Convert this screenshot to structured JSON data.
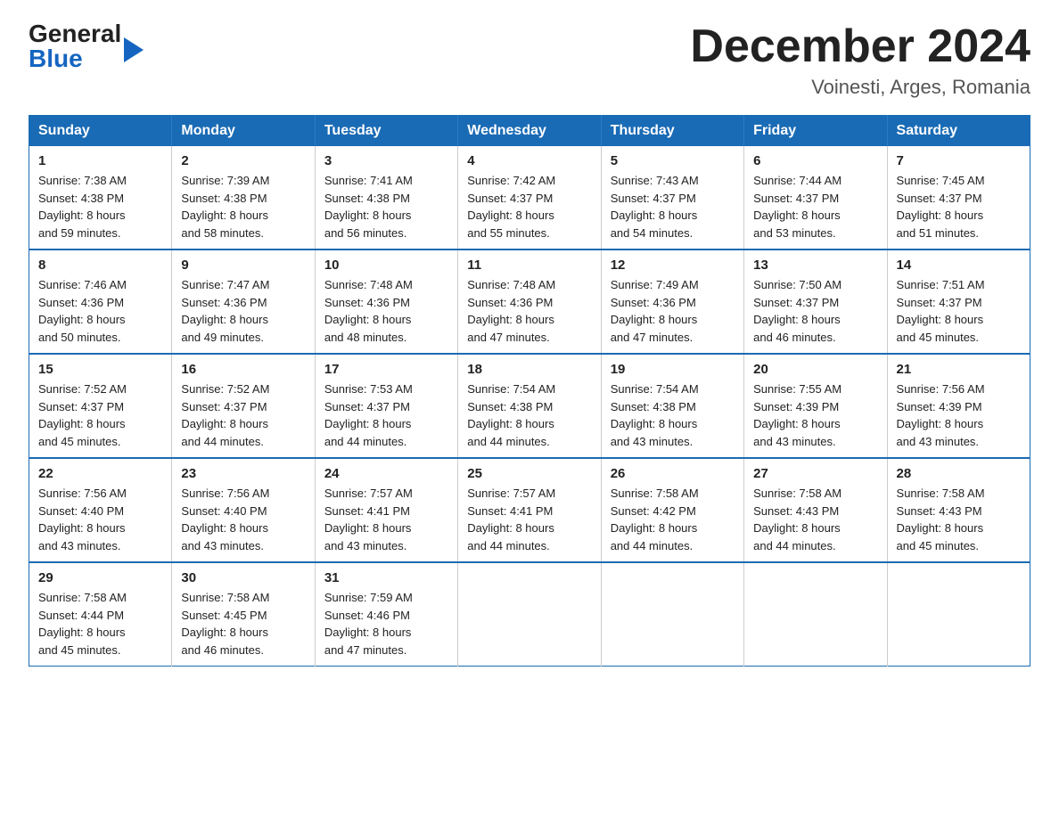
{
  "header": {
    "logo": {
      "line1": "General",
      "line2": "Blue"
    },
    "title": "December 2024",
    "location": "Voinesti, Arges, Romania"
  },
  "columns": [
    "Sunday",
    "Monday",
    "Tuesday",
    "Wednesday",
    "Thursday",
    "Friday",
    "Saturday"
  ],
  "weeks": [
    [
      {
        "day": "1",
        "sunrise": "7:38 AM",
        "sunset": "4:38 PM",
        "daylight": "8 hours and 59 minutes."
      },
      {
        "day": "2",
        "sunrise": "7:39 AM",
        "sunset": "4:38 PM",
        "daylight": "8 hours and 58 minutes."
      },
      {
        "day": "3",
        "sunrise": "7:41 AM",
        "sunset": "4:38 PM",
        "daylight": "8 hours and 56 minutes."
      },
      {
        "day": "4",
        "sunrise": "7:42 AM",
        "sunset": "4:37 PM",
        "daylight": "8 hours and 55 minutes."
      },
      {
        "day": "5",
        "sunrise": "7:43 AM",
        "sunset": "4:37 PM",
        "daylight": "8 hours and 54 minutes."
      },
      {
        "day": "6",
        "sunrise": "7:44 AM",
        "sunset": "4:37 PM",
        "daylight": "8 hours and 53 minutes."
      },
      {
        "day": "7",
        "sunrise": "7:45 AM",
        "sunset": "4:37 PM",
        "daylight": "8 hours and 51 minutes."
      }
    ],
    [
      {
        "day": "8",
        "sunrise": "7:46 AM",
        "sunset": "4:36 PM",
        "daylight": "8 hours and 50 minutes."
      },
      {
        "day": "9",
        "sunrise": "7:47 AM",
        "sunset": "4:36 PM",
        "daylight": "8 hours and 49 minutes."
      },
      {
        "day": "10",
        "sunrise": "7:48 AM",
        "sunset": "4:36 PM",
        "daylight": "8 hours and 48 minutes."
      },
      {
        "day": "11",
        "sunrise": "7:48 AM",
        "sunset": "4:36 PM",
        "daylight": "8 hours and 47 minutes."
      },
      {
        "day": "12",
        "sunrise": "7:49 AM",
        "sunset": "4:36 PM",
        "daylight": "8 hours and 47 minutes."
      },
      {
        "day": "13",
        "sunrise": "7:50 AM",
        "sunset": "4:37 PM",
        "daylight": "8 hours and 46 minutes."
      },
      {
        "day": "14",
        "sunrise": "7:51 AM",
        "sunset": "4:37 PM",
        "daylight": "8 hours and 45 minutes."
      }
    ],
    [
      {
        "day": "15",
        "sunrise": "7:52 AM",
        "sunset": "4:37 PM",
        "daylight": "8 hours and 45 minutes."
      },
      {
        "day": "16",
        "sunrise": "7:52 AM",
        "sunset": "4:37 PM",
        "daylight": "8 hours and 44 minutes."
      },
      {
        "day": "17",
        "sunrise": "7:53 AM",
        "sunset": "4:37 PM",
        "daylight": "8 hours and 44 minutes."
      },
      {
        "day": "18",
        "sunrise": "7:54 AM",
        "sunset": "4:38 PM",
        "daylight": "8 hours and 44 minutes."
      },
      {
        "day": "19",
        "sunrise": "7:54 AM",
        "sunset": "4:38 PM",
        "daylight": "8 hours and 43 minutes."
      },
      {
        "day": "20",
        "sunrise": "7:55 AM",
        "sunset": "4:39 PM",
        "daylight": "8 hours and 43 minutes."
      },
      {
        "day": "21",
        "sunrise": "7:56 AM",
        "sunset": "4:39 PM",
        "daylight": "8 hours and 43 minutes."
      }
    ],
    [
      {
        "day": "22",
        "sunrise": "7:56 AM",
        "sunset": "4:40 PM",
        "daylight": "8 hours and 43 minutes."
      },
      {
        "day": "23",
        "sunrise": "7:56 AM",
        "sunset": "4:40 PM",
        "daylight": "8 hours and 43 minutes."
      },
      {
        "day": "24",
        "sunrise": "7:57 AM",
        "sunset": "4:41 PM",
        "daylight": "8 hours and 43 minutes."
      },
      {
        "day": "25",
        "sunrise": "7:57 AM",
        "sunset": "4:41 PM",
        "daylight": "8 hours and 44 minutes."
      },
      {
        "day": "26",
        "sunrise": "7:58 AM",
        "sunset": "4:42 PM",
        "daylight": "8 hours and 44 minutes."
      },
      {
        "day": "27",
        "sunrise": "7:58 AM",
        "sunset": "4:43 PM",
        "daylight": "8 hours and 44 minutes."
      },
      {
        "day": "28",
        "sunrise": "7:58 AM",
        "sunset": "4:43 PM",
        "daylight": "8 hours and 45 minutes."
      }
    ],
    [
      {
        "day": "29",
        "sunrise": "7:58 AM",
        "sunset": "4:44 PM",
        "daylight": "8 hours and 45 minutes."
      },
      {
        "day": "30",
        "sunrise": "7:58 AM",
        "sunset": "4:45 PM",
        "daylight": "8 hours and 46 minutes."
      },
      {
        "day": "31",
        "sunrise": "7:59 AM",
        "sunset": "4:46 PM",
        "daylight": "8 hours and 47 minutes."
      },
      null,
      null,
      null,
      null
    ]
  ],
  "labels": {
    "sunrise": "Sunrise:",
    "sunset": "Sunset:",
    "daylight": "Daylight:"
  }
}
